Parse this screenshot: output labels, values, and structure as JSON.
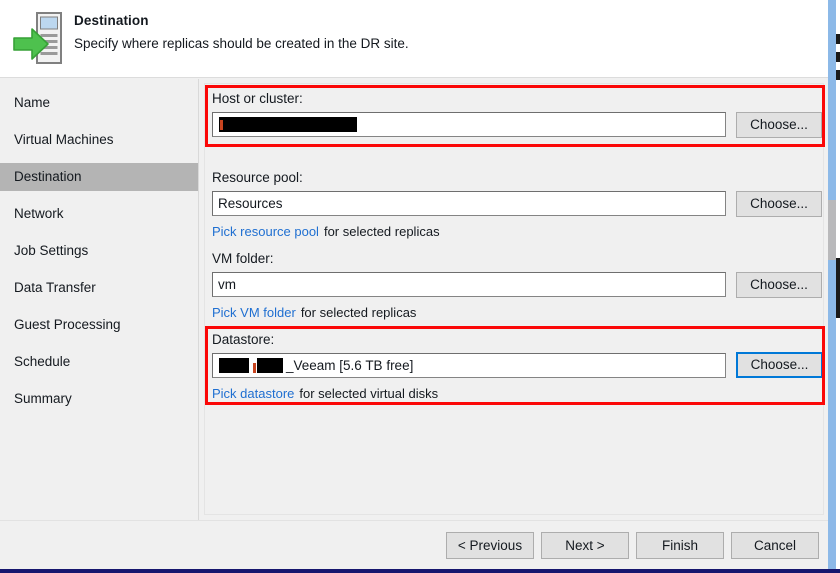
{
  "window": {
    "accent_blue": "#0078d7",
    "highlight_red": "#fb0707",
    "link_blue": "#1f6fd1",
    "selected_nav_bg": "#b4b4b4"
  },
  "header": {
    "icon": "server-replica-icon",
    "title": "Destination",
    "subtitle": "Specify where replicas should be created in the DR site."
  },
  "sidebar": {
    "items": [
      {
        "label": "Name",
        "selected": false
      },
      {
        "label": "Virtual Machines",
        "selected": false
      },
      {
        "label": "Destination",
        "selected": true
      },
      {
        "label": "Network",
        "selected": false
      },
      {
        "label": "Job Settings",
        "selected": false
      },
      {
        "label": "Data Transfer",
        "selected": false
      },
      {
        "label": "Guest Processing",
        "selected": false
      },
      {
        "label": "Schedule",
        "selected": false
      },
      {
        "label": "Summary",
        "selected": false
      }
    ]
  },
  "fields": {
    "host_or_cluster": {
      "label": "Host or cluster:",
      "value": "",
      "redacted": true,
      "highlighted": true,
      "choose_label": "Choose...",
      "choose_focused": false
    },
    "resource_pool": {
      "label": "Resource pool:",
      "value": "Resources",
      "redacted": false,
      "highlighted": false,
      "choose_label": "Choose...",
      "choose_focused": false,
      "hint_link": "Pick resource pool",
      "hint_text": "for selected replicas"
    },
    "vm_folder": {
      "label": "VM folder:",
      "value": "vm",
      "redacted": false,
      "highlighted": false,
      "choose_label": "Choose...",
      "choose_focused": false,
      "hint_link": "Pick VM folder",
      "hint_text": "for selected replicas"
    },
    "datastore": {
      "label": "Datastore:",
      "value": "_Veeam [5.6 TB free]",
      "redacted": true,
      "highlighted": true,
      "choose_label": "Choose...",
      "choose_focused": true,
      "hint_link": "Pick datastore",
      "hint_text": "for selected virtual disks"
    }
  },
  "footer": {
    "previous_label": "< Previous",
    "next_label": "Next >",
    "finish_label": "Finish",
    "cancel_label": "Cancel"
  }
}
